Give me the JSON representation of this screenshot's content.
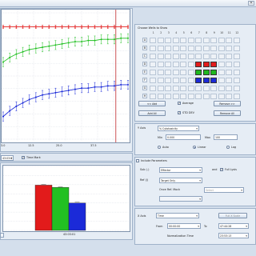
{
  "window": {
    "close_glyph": "✕"
  },
  "wells": {
    "title": "Choose Wells to Show",
    "rows": [
      "A",
      "B",
      "C",
      "D",
      "E",
      "F",
      "G",
      "H"
    ],
    "cols": [
      "1",
      "2",
      "3",
      "4",
      "5",
      "6",
      "7",
      "8",
      "9",
      "10",
      "11",
      "12"
    ],
    "selected": [
      {
        "row": 3,
        "cols": [
          6,
          7,
          8
        ],
        "color": "#e21b1b"
      },
      {
        "row": 4,
        "cols": [
          6,
          7,
          8
        ],
        "color": "#1fb81f"
      },
      {
        "row": 5,
        "cols": [
          6,
          7,
          8
        ],
        "color": "#1b2ad8"
      }
    ]
  },
  "groups": {
    "add_label": "<< Add",
    "remove_label": "Remove >>",
    "add_all_label": "Add All",
    "remove_all_label": "Remove All",
    "average_label": "Average",
    "stddev_label": "STD DEV",
    "average_checked": true,
    "stddev_checked": true
  },
  "y_axis": {
    "label": "Y Axis",
    "mode": "% Cytotoxicity",
    "min_label": "Min",
    "min_value": "0.000",
    "max_label": "Max",
    "max_value": "100",
    "options": [
      "Auto",
      "Linear",
      "Log"
    ],
    "selected": "Linear"
  },
  "params": {
    "label": "Include Parameters",
    "checked": false,
    "sub_label": "Sub (-)",
    "sub_value": "Effector",
    "and_label": "and",
    "full_lysis_label": "Full Lysis",
    "full_lysis_checked": true,
    "ref_label": "Ref (/)",
    "ref_value": "Target Only",
    "once_label": "Once Ref. Mock",
    "once_value": "Select"
  },
  "x_axis": {
    "label": "X Axis",
    "mode": "Time",
    "full_scale_label": "Full X Scale",
    "from_label": "From",
    "from_value": "00:00:00",
    "to_label": "To",
    "to_value": "47:44:28",
    "norm_label": "Normalization Time",
    "norm_value": "23:53:13"
  },
  "bottom_toolbar": {
    "time_value": "43:03:01",
    "time_mark_label": "Time Mark",
    "time_mark_checked": true
  },
  "line_chart": {
    "x_ticks": [
      "3.0",
      "12.5",
      "25.0",
      "37.5"
    ]
  },
  "chart_data": [
    {
      "type": "line",
      "xlim": [
        0,
        47.7
      ],
      "ylim": [
        0,
        110
      ],
      "x": [
        0,
        2.5,
        5,
        7.5,
        10,
        12.5,
        15,
        17.5,
        20,
        22.5,
        25,
        27.5,
        30,
        32.5,
        35,
        37.5,
        40,
        42.5,
        45,
        47.7
      ],
      "series": [
        {
          "color": "#e21b1b",
          "values": [
            99,
            99,
            99,
            99,
            99,
            99,
            99,
            99,
            99,
            99,
            99,
            99,
            99,
            99,
            99,
            99,
            99,
            99,
            99,
            99
          ]
        },
        {
          "color": "#22c022",
          "values": [
            68,
            72,
            75,
            77,
            79,
            80,
            81,
            82,
            83,
            84,
            85,
            86,
            86,
            87,
            87,
            88,
            88,
            88,
            89,
            89
          ]
        },
        {
          "color": "#1b2ad8",
          "values": [
            20,
            25,
            29,
            32,
            35,
            37,
            39,
            40,
            41,
            42,
            43,
            44,
            45,
            45,
            46,
            46,
            47,
            47,
            48,
            48
          ]
        }
      ],
      "time_mark": 43.05,
      "grid": true
    },
    {
      "type": "bar",
      "categories": [
        "43:03:01"
      ],
      "series": [
        {
          "color": "#e21b1b",
          "values": [
            99
          ]
        },
        {
          "color": "#22c022",
          "values": [
            94
          ]
        },
        {
          "color": "#1b2ad8",
          "values": [
            60
          ]
        }
      ],
      "ylim": [
        0,
        140
      ]
    }
  ]
}
